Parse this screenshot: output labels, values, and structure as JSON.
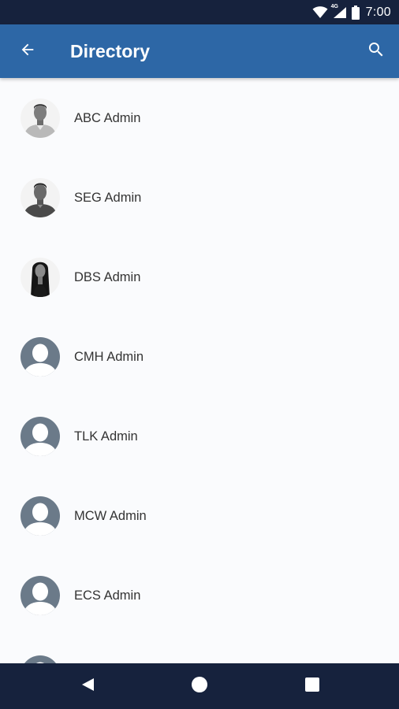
{
  "status_bar": {
    "time": "7:00",
    "network_type": "4G",
    "icons": [
      "wifi-icon",
      "cellular-signal-icon",
      "battery-icon"
    ]
  },
  "app_bar": {
    "title": "Directory",
    "back_icon": "arrow-back-icon",
    "search_icon": "search-icon",
    "color": "#2d67a6"
  },
  "directory": {
    "items": [
      {
        "name": "ABC  Admin",
        "avatar": "photo"
      },
      {
        "name": "SEG Admin",
        "avatar": "photo"
      },
      {
        "name": "DBS Admin",
        "avatar": "photo"
      },
      {
        "name": "CMH Admin",
        "avatar": "placeholder"
      },
      {
        "name": "TLK Admin",
        "avatar": "placeholder"
      },
      {
        "name": "MCW Admin",
        "avatar": "placeholder"
      },
      {
        "name": "ECS Admin",
        "avatar": "placeholder"
      }
    ]
  },
  "nav_bar": {
    "icons": [
      "nav-back-icon",
      "nav-home-icon",
      "nav-recents-icon"
    ]
  },
  "colors": {
    "status_bar": "#16223d",
    "app_bar": "#2d67a6",
    "placeholder_avatar": "#6b7a89",
    "list_background": "#fafbfd"
  }
}
